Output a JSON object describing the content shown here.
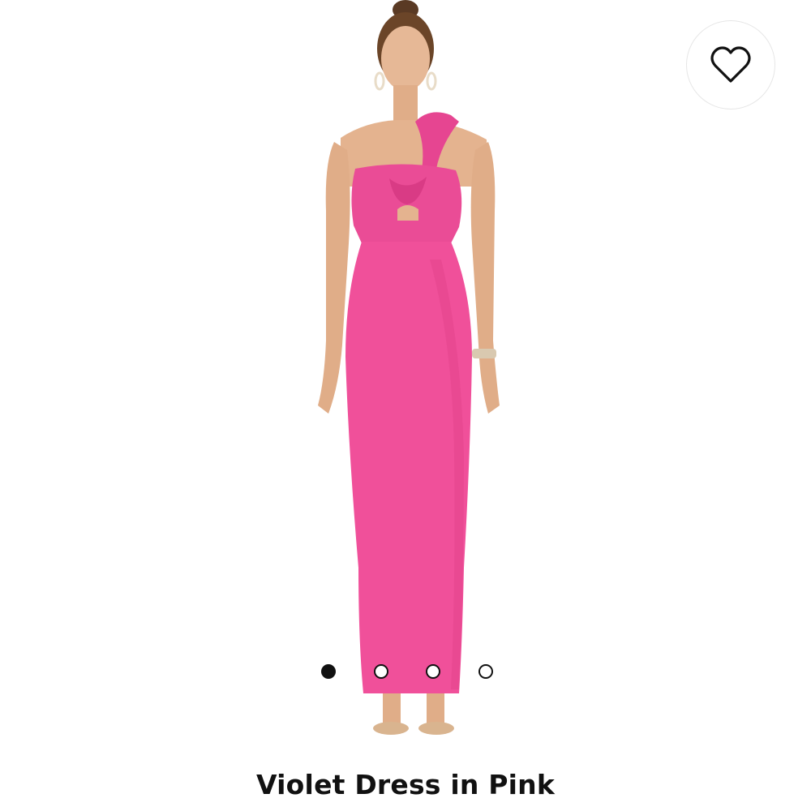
{
  "product": {
    "title": "Violet Dress in Pink",
    "image_alt": "Model wearing pink one-shoulder twist maxi dress with cut-out"
  },
  "wishlist": {
    "icon": "heart-outline-icon"
  },
  "carousel": {
    "total_slides": 4,
    "active_index": 0
  },
  "colors": {
    "dress": "#f0509a",
    "background": "#ffffff",
    "text": "#111111"
  }
}
